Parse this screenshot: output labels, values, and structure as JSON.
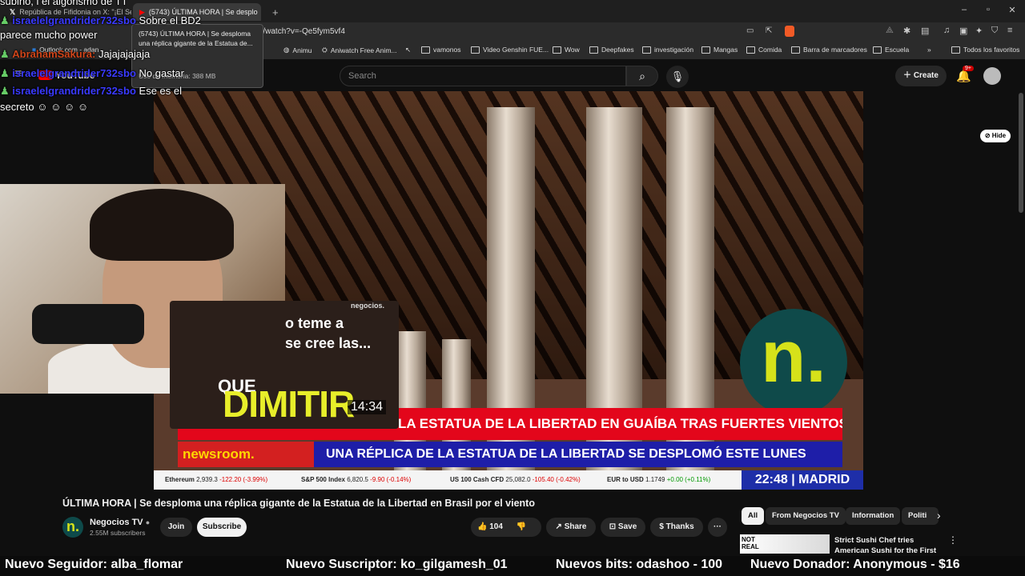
{
  "browser": {
    "tabs": [
      {
        "title": "República de Fifidonia on X: \"¡El Seño"
      },
      {
        "title": "(5743) ÚLTIMA HORA | Se desplo"
      }
    ],
    "new_tab": "+",
    "url": "ube.com/watch?v=-Qe5fym5vf4",
    "tooltip": {
      "title": "(5743) ÚLTIMA HORA | Se desploma una réplica gigante de la Estatua de...",
      "memory": "Uso de memoria: 388 MB"
    },
    "bookmarks": [
      "Outlook.com - adan",
      "Animu",
      "Aniwatch Free Anim...",
      "vamonos",
      "Video Genshin FUE...",
      "Wow",
      "Deepfakes",
      "investigación",
      "Mangas",
      "Comida",
      "Barra de marcadores",
      "Escuela"
    ],
    "all_bookmarks": "Todos los favoritos"
  },
  "youtube": {
    "logo": "YouTube",
    "search_placeholder": "Search",
    "create_label": "Create",
    "notif_badge": "9+",
    "hide_label": "Hide"
  },
  "video": {
    "band1": "LA ESTATUA DE LA LIBERTAD EN GUAÍBA TRAS FUERTES VIENTOS",
    "newsroom": "newsroom.",
    "band2": "UNA RÉPLICA DE LA ESTATUA DE LA LIBERTAD SE DESPLOMÓ ESTE LUNES",
    "logo_letter": "n.",
    "clock": "22:48",
    "city": "MADRID",
    "ticker": [
      {
        "name": "Ethereum",
        "value": "2,939.3",
        "change": "-122.20 (-3.99%)"
      },
      {
        "name": "S&P 500 Index",
        "value": "6,820.5",
        "change": "-9.90 (-0.14%)"
      },
      {
        "name": "US 100 Cash CFD",
        "value": "25,082.0",
        "change": "-105.40 (-0.42%)"
      },
      {
        "name": "EUR to USD",
        "value": "1.1749",
        "change": "+0.00 (+0.11%)"
      }
    ]
  },
  "preview": {
    "watermark": "negocios.",
    "line1": "o teme a",
    "line2": "se cree las...",
    "line3": "QUE",
    "big": "DIMITIR",
    "duration": "14:34"
  },
  "chat": [
    {
      "user": "",
      "text": "subiño, i el algorismo de TT"
    },
    {
      "user": "israelelgrandrider732sbo",
      "text": "Sobre el BD2"
    },
    {
      "user": "",
      "text": "parece mucho power"
    },
    {
      "user": "AbrahamSakura:",
      "text": "Jajajajajaja"
    },
    {
      "user": "israelelgrandrider732sbo",
      "text": "No gastar"
    },
    {
      "user": "israelelgrandrider732sbo",
      "text": "Ese es el"
    },
    {
      "user": "",
      "text": "secreto"
    }
  ],
  "info": {
    "title": "ÚLTIMA HORA | Se desploma una réplica gigante de la Estatua de la Libertad en Brasil por el viento",
    "channel": "Negocios TV",
    "subscribers": "2.55M subscribers",
    "join": "Join",
    "subscribe": "Subscribe",
    "likes": "104",
    "share": "Share",
    "save": "Save",
    "thanks": "Thanks",
    "more": "···"
  },
  "chips": [
    "All",
    "From Negocios TV",
    "Information",
    "Politi"
  ],
  "recommendation": {
    "title": "Strict Sushi Chef tries American Sushi for the First Time",
    "thumb_text": "NOT REAL"
  },
  "alerts": [
    "Nuevo Seguidor: alba_flomar",
    "Nuevo Suscriptor: ko_gilgamesh_01",
    "Nuevos bits: odashoo - 100",
    "Nuevo Donador: Anonymous - $16"
  ],
  "colors": {
    "accent_red": "#e3061b",
    "news_blue": "#1e1ea8",
    "brand_teal": "#0f4a4a",
    "brand_yellow": "#d6e21a",
    "chat_user": "#3a3aff"
  }
}
